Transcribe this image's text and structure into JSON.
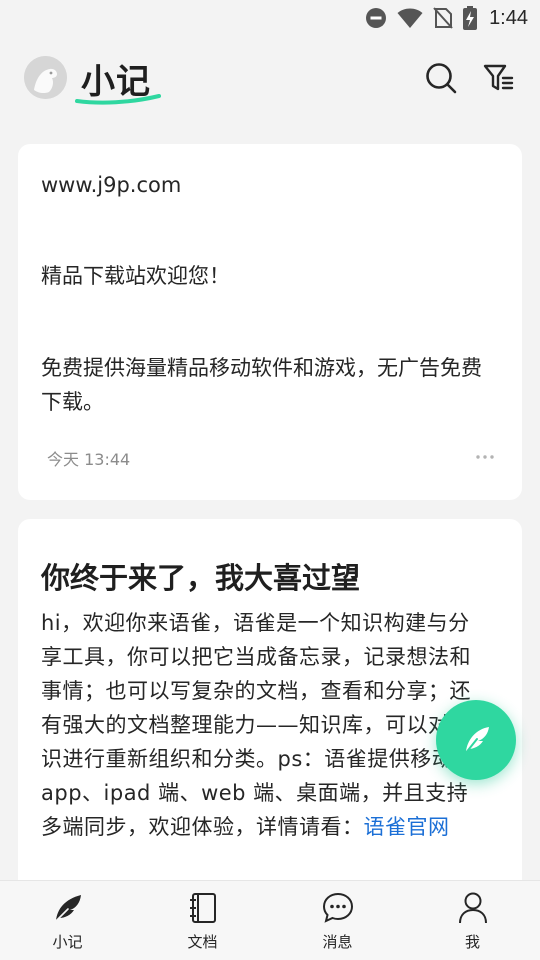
{
  "status_bar": {
    "time": "1:44",
    "icons": [
      "do-not-disturb-icon",
      "wifi-icon",
      "no-sim-icon",
      "battery-charging-icon"
    ]
  },
  "header": {
    "title": "小记",
    "avatar_icon": "avatar-bird-icon",
    "search_icon": "search-icon",
    "filter_icon": "filter-icon"
  },
  "notes": [
    {
      "lines": [
        "www.j9p.com",
        "精品下载站欢迎您！",
        "免费提供海量精品移动软件和游戏，无广告免费下载。"
      ],
      "time": "今天 13:44",
      "more_icon": "more-dots-icon"
    },
    {
      "title": "你终于来了，我大喜过望",
      "body": "hi，欢迎你来语雀，语雀是一个知识构建与分享工具，你可以把它当成备忘录，记录想法和事情；也可以写复杂的文档，查看和分享；还有强大的文档整理能力——知识库，可以对知识进行重新组织和分类。ps：语雀提供移动端 app、ipad 端、web 端、桌面端，并且支持多端同步，欢迎体验，详情请看：",
      "link": "语雀官网"
    }
  ],
  "fab": {
    "icon": "feather-pen-icon"
  },
  "bottom_nav": [
    {
      "label": "小记",
      "icon": "feather-icon"
    },
    {
      "label": "文档",
      "icon": "notebook-icon"
    },
    {
      "label": "消息",
      "icon": "chat-bubble-icon"
    },
    {
      "label": "我",
      "icon": "person-icon"
    }
  ],
  "colors": {
    "accent": "#2fd7a0",
    "link": "#1b6fd6",
    "background": "#f3f3f3"
  }
}
